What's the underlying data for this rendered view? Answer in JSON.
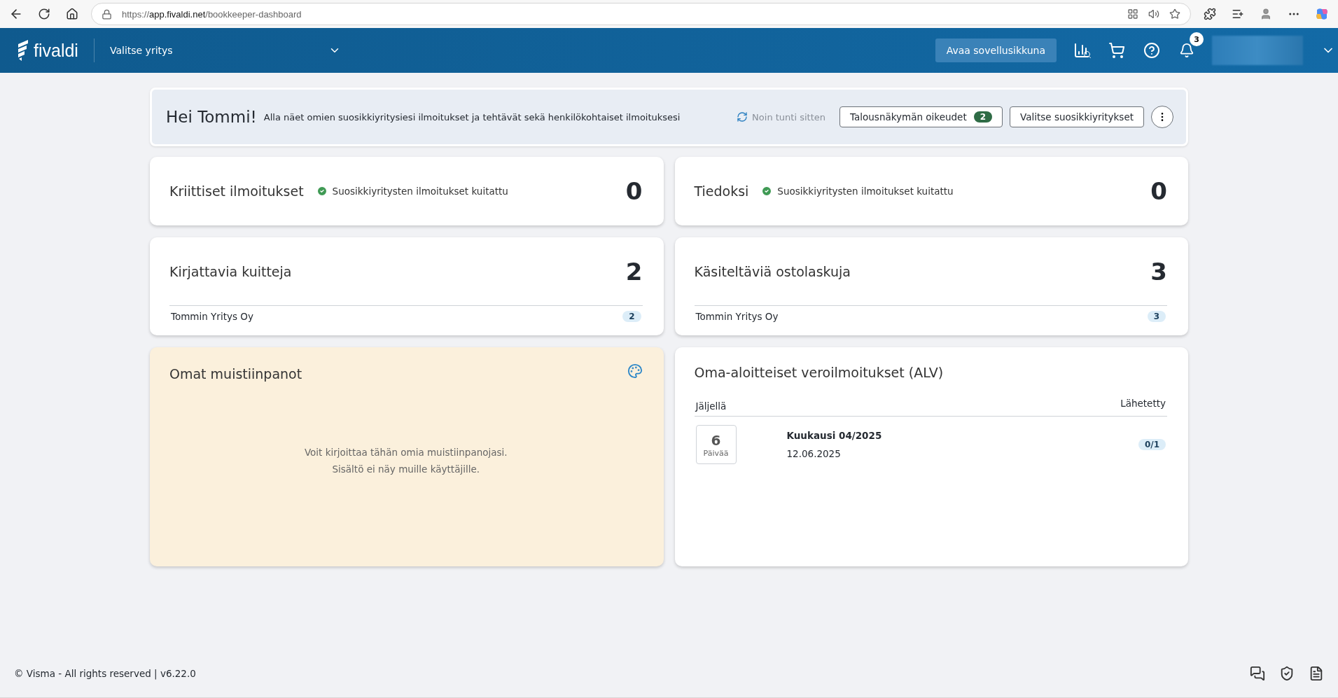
{
  "browser": {
    "url": {
      "scheme": "https://",
      "host": "app.fivaldi.net",
      "path": "/bookkeeper-dashboard"
    }
  },
  "header": {
    "logo": "fivaldi",
    "company_select": "Valitse yritys",
    "open_button": "Avaa sovellusikkuna",
    "notification_count": "3"
  },
  "greeting": {
    "title": "Hei Tommi!",
    "text": "Alla näet omien suosikkiyritysiesi ilmoitukset ja tehtävät sekä henkilökohtaiset ilmoituksesi",
    "refreshed": "Noin tunti sitten",
    "buttons": [
      {
        "label": "Talousnäkymän oikeudet",
        "badge": "2"
      },
      {
        "label": "Valitse suosikkiyritykset"
      }
    ]
  },
  "cards": [
    {
      "kind": "status",
      "title": "Kriittiset ilmoitukset",
      "status": "Suosikkiyritysten ilmoitukset kuitattu",
      "count": "0"
    },
    {
      "kind": "status",
      "title": "Tiedoksi",
      "status": "Suosikkiyritysten ilmoitukset kuitattu",
      "count": "0"
    },
    {
      "kind": "list",
      "title": "Kirjattavia kuitteja",
      "count": "2",
      "rows": [
        {
          "name": "Tommin Yritys Oy",
          "count": "2"
        }
      ]
    },
    {
      "kind": "list",
      "title": "Käsiteltäviä ostolaskuja",
      "count": "3",
      "rows": [
        {
          "name": "Tommin Yritys Oy",
          "count": "3"
        }
      ]
    }
  ],
  "notes": {
    "title": "Omat muistiinpanot",
    "lines": [
      "Voit kirjoittaa tähän omia muistiinpanojasi.",
      "Sisältö ei näy muille käyttäjille."
    ]
  },
  "vat": {
    "title": "Oma-aloitteiset veroilmoitukset (ALV)",
    "columns": [
      "Jäljellä",
      "Lähetetty"
    ],
    "rows": [
      {
        "days": "6",
        "unit": "Päivää",
        "period": "Kuukausi 04/2025",
        "date": "12.06.2025",
        "sent": "0/1"
      }
    ]
  },
  "footer": {
    "text": "© Visma - All rights reserved | v6.22.0"
  }
}
